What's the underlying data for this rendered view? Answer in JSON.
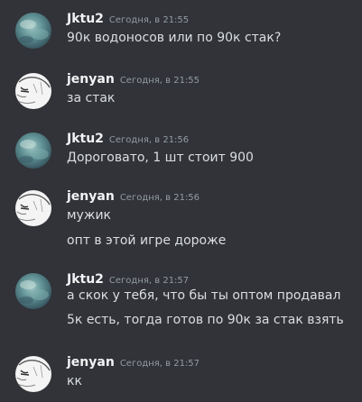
{
  "messages": [
    {
      "username": "Jktu2",
      "timestamp": "Сегодня, в 21:55",
      "avatar": "blue-ocean-avatar",
      "lines": [
        "90к водоносов или по 90к стак?"
      ]
    },
    {
      "username": "jenyan",
      "timestamp": "Сегодня, в 21:55",
      "avatar": "anime-sketch-avatar",
      "lines": [
        "за стак"
      ]
    },
    {
      "username": "Jktu2",
      "timestamp": "Сегодня, в 21:56",
      "avatar": "blue-ocean-avatar",
      "lines": [
        "Дороговато, 1 шт стоит 900"
      ]
    },
    {
      "username": "jenyan",
      "timestamp": "Сегодня, в 21:56",
      "avatar": "anime-sketch-avatar",
      "lines": [
        "мужик",
        "опт в этой игре дороже"
      ]
    },
    {
      "username": "Jktu2",
      "timestamp": "Сегодня, в 21:57",
      "avatar": "blue-ocean-avatar",
      "lines": [
        "а скок у тебя, что бы ты оптом продавал",
        "5к есть, тогда готов по 90к за стак взять"
      ]
    },
    {
      "username": "jenyan",
      "timestamp": "Сегодня, в 21:57",
      "avatar": "anime-sketch-avatar",
      "lines": [
        "кк"
      ]
    }
  ],
  "colors": {
    "background": "#313338",
    "username": "#f2f3f5",
    "message_text": "#dbdee1",
    "timestamp": "#949ba4"
  }
}
